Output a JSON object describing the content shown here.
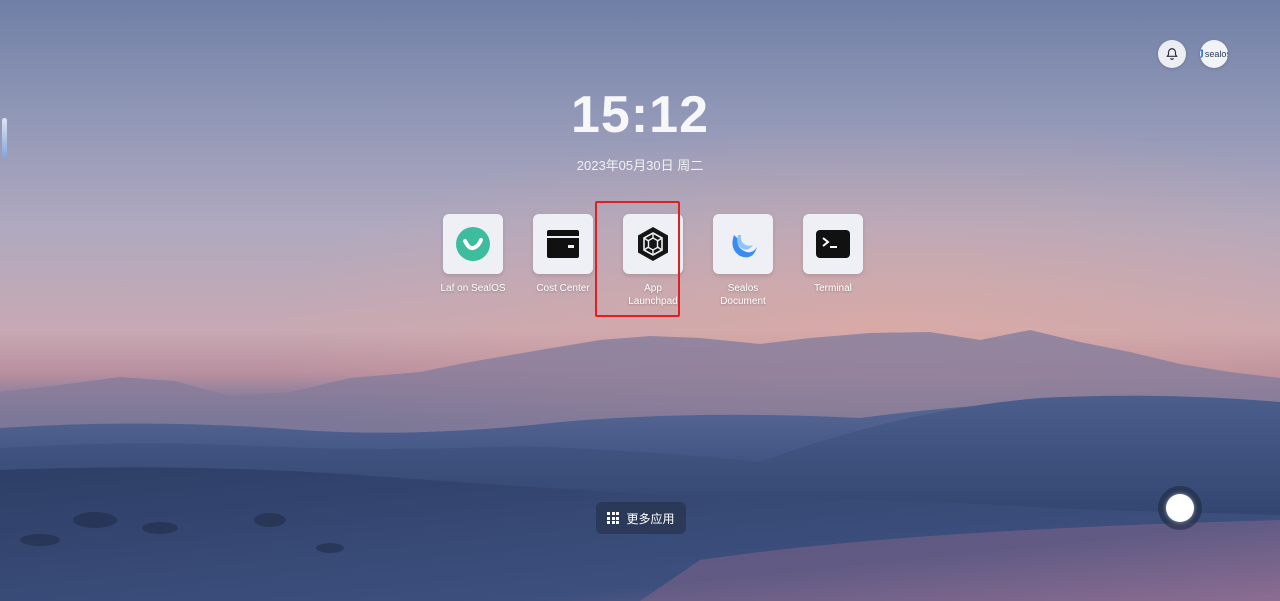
{
  "clock": {
    "time": "15:12",
    "date": "2023年05月30日 周二"
  },
  "header": {
    "notification_icon": "bell-icon",
    "avatar_text": "sealos"
  },
  "apps": [
    {
      "label": "Laf on SealOS",
      "icon": "laf-icon",
      "selected": false
    },
    {
      "label": "Cost Center",
      "icon": "wallet-icon",
      "selected": false
    },
    {
      "label": "App Launchpad",
      "icon": "hexagon-icon",
      "selected": true
    },
    {
      "label": "Sealos Document",
      "icon": "sealos-doc-icon",
      "selected": false
    },
    {
      "label": "Terminal",
      "icon": "terminal-icon",
      "selected": false
    }
  ],
  "more_apps": {
    "label": "更多应用",
    "icon": "grid-icon"
  },
  "colors": {
    "highlight": "#e02020",
    "laf_green": "#3ebc9e",
    "sealos_blue": "#3b8cf2"
  }
}
